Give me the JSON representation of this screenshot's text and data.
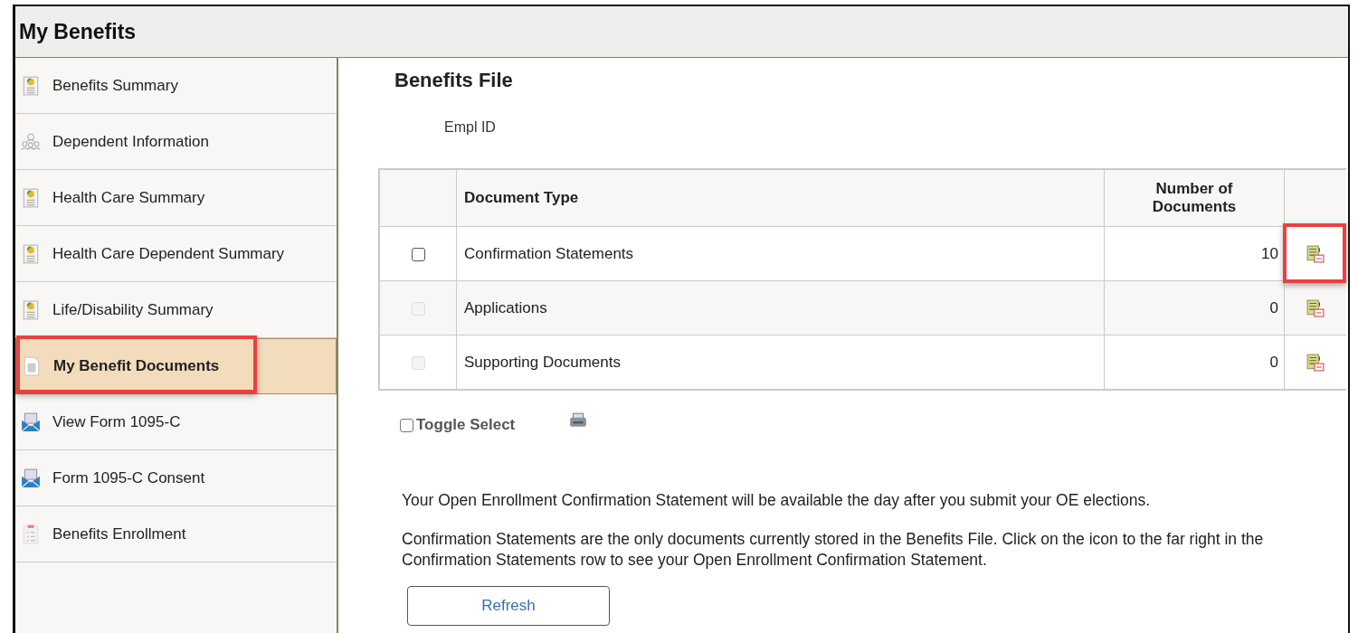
{
  "window": {
    "title": "My Benefits"
  },
  "sidebar": {
    "items": [
      {
        "label": "Benefits Summary",
        "kind": "report",
        "selected": false,
        "highlighted": false
      },
      {
        "label": "Dependent Information",
        "kind": "people",
        "selected": false,
        "highlighted": false
      },
      {
        "label": "Health Care Summary",
        "kind": "report",
        "selected": false,
        "highlighted": false
      },
      {
        "label": "Health Care Dependent Summary",
        "kind": "report",
        "selected": false,
        "highlighted": false
      },
      {
        "label": "Life/Disability Summary",
        "kind": "report",
        "selected": false,
        "highlighted": false
      },
      {
        "label": "My Benefit Documents",
        "kind": "page",
        "selected": true,
        "highlighted": true
      },
      {
        "label": "View Form 1095-C",
        "kind": "envelope",
        "selected": false,
        "highlighted": false
      },
      {
        "label": "Form 1095-C Consent",
        "kind": "envelope",
        "selected": false,
        "highlighted": false
      },
      {
        "label": "Benefits Enrollment",
        "kind": "checklist",
        "selected": false,
        "highlighted": false
      }
    ]
  },
  "main": {
    "title": "Benefits File",
    "empl_id_label": "Empl ID",
    "table": {
      "columns": [
        "Document Type",
        "Number of Documents"
      ],
      "rows": [
        {
          "document_type": "Confirmation Statements",
          "count": "10",
          "checked": false,
          "disabled": false,
          "icon_highlighted": true
        },
        {
          "document_type": "Applications",
          "count": "0",
          "checked": false,
          "disabled": true,
          "icon_highlighted": false
        },
        {
          "document_type": "Supporting Documents",
          "count": "0",
          "checked": false,
          "disabled": true,
          "icon_highlighted": false
        }
      ]
    },
    "toggle_select": {
      "label": "Toggle Select",
      "checked": false
    },
    "notes": [
      "Your Open Enrollment Confirmation Statement will be available the day after you submit your OE elections.",
      "Confirmation Statements are the only documents currently stored in the Benefits File.  Click on the icon to the far right in the Confirmation Statements row to see your Open Enrollment Confirmation Statement."
    ],
    "refresh_button": "Refresh"
  }
}
